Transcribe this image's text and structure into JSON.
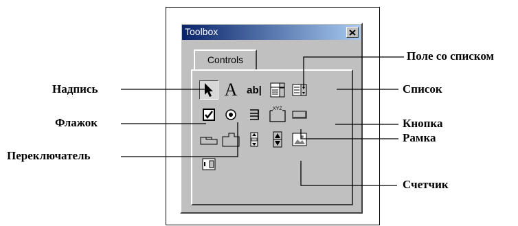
{
  "window": {
    "title": "Toolbox",
    "tab": "Controls"
  },
  "tools": {
    "pointer": "pointer-icon",
    "label": "A",
    "textbox": "ab|",
    "combobox": "combobox-icon",
    "listbox": "listbox-icon",
    "checkbox": "checkbox-icon",
    "option": "option-button-icon",
    "toggle": "toggle-button-icon",
    "frame": "XYZ",
    "commandbutton": "command-button-icon",
    "tabstrip": "tabstrip-icon",
    "multipage": "multipage-icon",
    "scrollbar": "scrollbar-icon",
    "spinbutton": "spinbutton-icon",
    "image": "image-icon",
    "refedit": "refedit-icon"
  },
  "callouts": {
    "label": "Надпись",
    "checkbox": "Флажок",
    "option": "Переключатель",
    "combobox": "Поле со списком",
    "listbox": "Список",
    "button": "Кнопка",
    "frame": "Рамка",
    "spinner": "Счетчик"
  }
}
